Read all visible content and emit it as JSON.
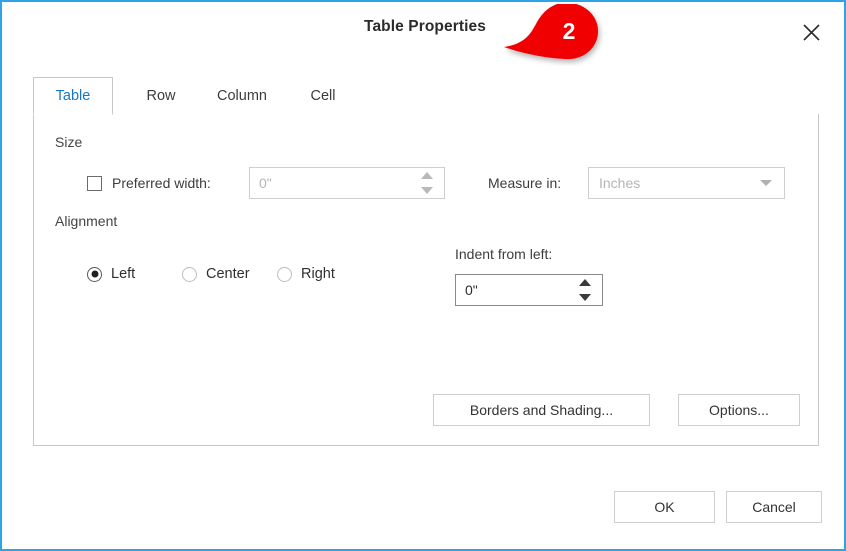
{
  "dialog": {
    "title": "Table Properties",
    "close_icon": "close-x-icon"
  },
  "callout": {
    "number": "2",
    "color": "#f00000"
  },
  "tabs": [
    {
      "label": "Table",
      "active": true
    },
    {
      "label": "Row",
      "active": false
    },
    {
      "label": "Column",
      "active": false
    },
    {
      "label": "Cell",
      "active": false
    }
  ],
  "size_group": {
    "label": "Size",
    "preferred_width": {
      "checkbox_label": "Preferred width:",
      "checked": false,
      "value": "0\"",
      "enabled": false,
      "spinner_icon": "spinner-arrows-icon"
    },
    "measure_in": {
      "label": "Measure in:",
      "value": "Inches",
      "enabled": false,
      "chevron_icon": "chevron-down-icon"
    }
  },
  "alignment_group": {
    "label": "Alignment",
    "options": [
      {
        "label": "Left",
        "selected": true
      },
      {
        "label": "Center",
        "selected": false
      },
      {
        "label": "Right",
        "selected": false
      }
    ],
    "indent": {
      "label": "Indent from left:",
      "value": "0\"",
      "enabled": true,
      "spinner_icon": "spinner-arrows-icon"
    }
  },
  "panel_buttons": {
    "borders_and_shading": "Borders and Shading...",
    "options": "Options..."
  },
  "footer_buttons": {
    "ok": "OK",
    "cancel": "Cancel"
  },
  "colors": {
    "window_border": "#2ea3e8",
    "accent_tab": "#1878c8",
    "callout_red": "#f00000"
  }
}
